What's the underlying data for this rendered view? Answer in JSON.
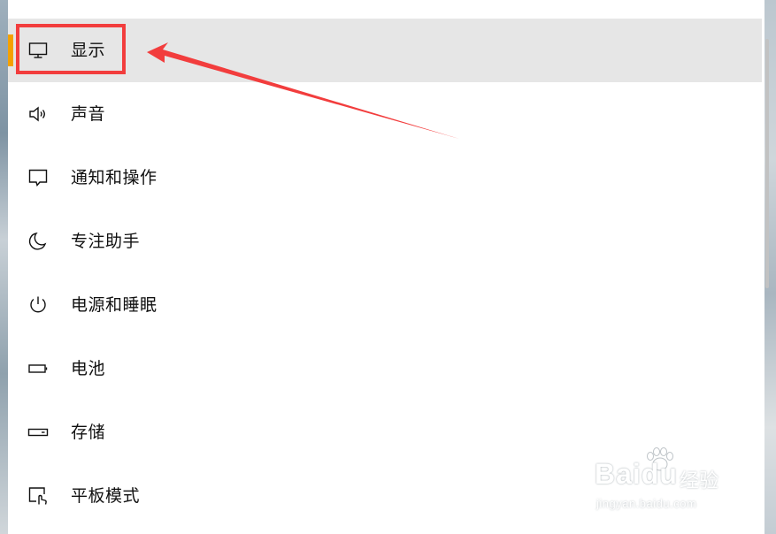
{
  "menu": {
    "items": [
      {
        "label": "显示",
        "icon": "monitor-icon",
        "selected": true
      },
      {
        "label": "声音",
        "icon": "speaker-icon"
      },
      {
        "label": "通知和操作",
        "icon": "notification-icon"
      },
      {
        "label": "专注助手",
        "icon": "moon-icon"
      },
      {
        "label": "电源和睡眠",
        "icon": "power-icon"
      },
      {
        "label": "电池",
        "icon": "battery-icon"
      },
      {
        "label": "存储",
        "icon": "storage-icon"
      },
      {
        "label": "平板模式",
        "icon": "tablet-mode-icon"
      }
    ]
  },
  "annotation": {
    "color": "#f23d3d",
    "target": "显示"
  },
  "accent_color": "#f4a100",
  "watermark": {
    "brand": "Baidu",
    "sub": "经验",
    "url": "jingyan.baidu.com"
  }
}
